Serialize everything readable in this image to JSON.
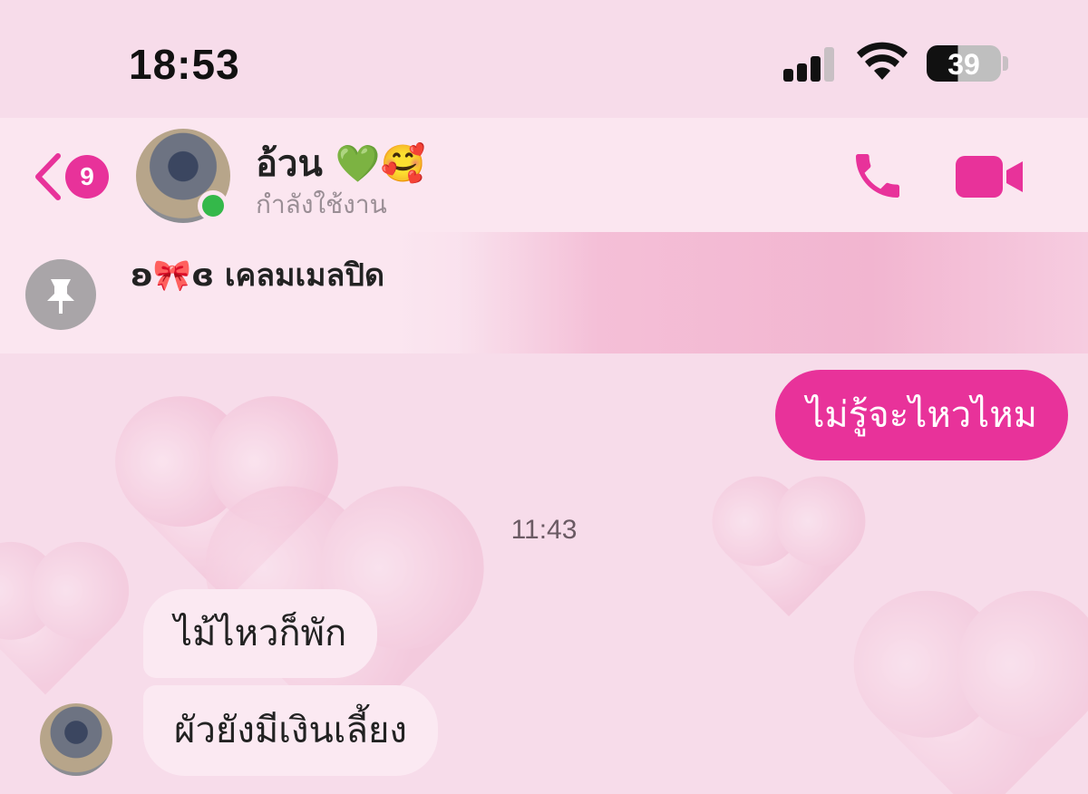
{
  "status_bar": {
    "time": "18:53",
    "battery": "39"
  },
  "header": {
    "unread_count": "9",
    "contact_name": "อ้วน 💚🥰",
    "status": "กำลังใช้งาน"
  },
  "pinned": {
    "text": "ʚ🎀ɞ เคลมเมลปิด"
  },
  "messages": [
    {
      "side": "out",
      "text": "ไม่รู้จะไหวไหม"
    },
    {
      "type": "time",
      "text": "11:43"
    },
    {
      "side": "in",
      "text": "ไม้ไหวก็พัก"
    },
    {
      "side": "in",
      "text": "ผัวยังมีเงินเลี้ยง"
    }
  ],
  "colors": {
    "accent": "#e8329a",
    "background": "#f7dcea",
    "online": "#34b84a"
  },
  "icons": [
    "back-chevron-icon",
    "phone-icon",
    "video-camera-icon",
    "pin-icon",
    "wifi-icon",
    "signal-icon",
    "battery-icon"
  ]
}
